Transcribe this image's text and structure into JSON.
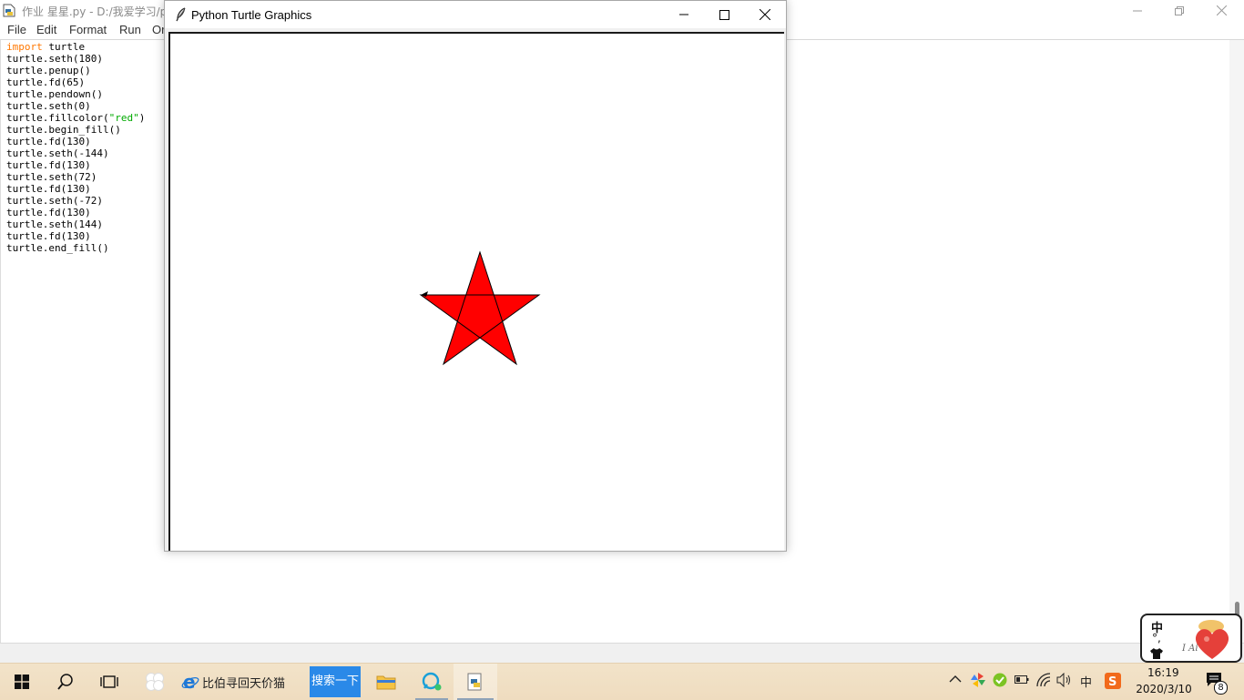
{
  "idle": {
    "title": "作业 星星.py - D:/我爱学习/p",
    "menus": [
      "File",
      "Edit",
      "Format",
      "Run",
      "Or"
    ],
    "code_lines": [
      [
        {
          "t": "import",
          "c": "kw"
        },
        {
          "t": " turtle",
          "c": ""
        }
      ],
      [
        {
          "t": "turtle.seth(180)",
          "c": ""
        }
      ],
      [
        {
          "t": "turtle.penup()",
          "c": ""
        }
      ],
      [
        {
          "t": "turtle.fd(65)",
          "c": ""
        }
      ],
      [
        {
          "t": "turtle.pendown()",
          "c": ""
        }
      ],
      [
        {
          "t": "turtle.seth(0)",
          "c": ""
        }
      ],
      [
        {
          "t": "turtle.fillcolor(",
          "c": ""
        },
        {
          "t": "\"red\"",
          "c": "str"
        },
        {
          "t": ")",
          "c": ""
        }
      ],
      [
        {
          "t": "turtle.begin_fill()",
          "c": ""
        }
      ],
      [
        {
          "t": "turtle.fd(130)",
          "c": ""
        }
      ],
      [
        {
          "t": "turtle.seth(-144)",
          "c": ""
        }
      ],
      [
        {
          "t": "turtle.fd(130)",
          "c": ""
        }
      ],
      [
        {
          "t": "turtle.seth(72)",
          "c": ""
        }
      ],
      [
        {
          "t": "turtle.fd(130)",
          "c": ""
        }
      ],
      [
        {
          "t": "turtle.seth(-72)",
          "c": ""
        }
      ],
      [
        {
          "t": "turtle.fd(130)",
          "c": ""
        }
      ],
      [
        {
          "t": "turtle.seth(144)",
          "c": ""
        }
      ],
      [
        {
          "t": "turtle.fd(130)",
          "c": ""
        }
      ],
      [
        {
          "t": "turtle.end_fill()",
          "c": ""
        }
      ]
    ]
  },
  "turtle_window": {
    "title": "Python Turtle Graphics",
    "fill_color": "#ff0000",
    "pen_color": "#000000"
  },
  "taskbar": {
    "ie_label": "比伯寻回天价猫",
    "search_label": "搜索一下",
    "time": "16:19",
    "date": "2020/3/10",
    "notification_count": "8",
    "ime_tray": "中"
  },
  "ime_widget": {
    "lang": "中",
    "punct": "°,"
  },
  "colors": {
    "accent_blue": "#2a89e8",
    "taskbar_bg": "#f0dfc3",
    "keyword_orange": "#ff7700",
    "string_green": "#00aa00"
  }
}
